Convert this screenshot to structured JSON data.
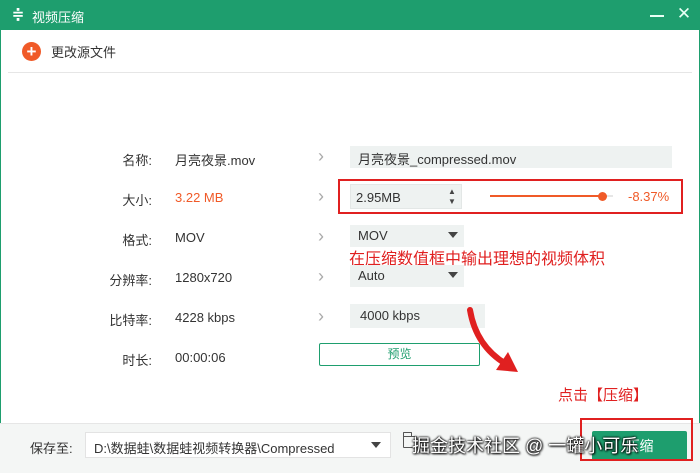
{
  "window": {
    "title": "视频压缩"
  },
  "toolbar": {
    "change_source_label": "更改源文件"
  },
  "rows": {
    "name": {
      "label": "名称:",
      "value": "月亮夜景.mov",
      "output": "月亮夜景_compressed.mov"
    },
    "size": {
      "label": "大小:",
      "value": "3.22 MB",
      "output": "2.95MB",
      "slider_fraction": 0.9163,
      "percent": "-8.37%"
    },
    "format": {
      "label": "格式:",
      "value": "MOV",
      "selected": "MOV"
    },
    "resolution": {
      "label": "分辨率:",
      "value": "1280x720",
      "selected": "Auto"
    },
    "bitrate": {
      "label": "比特率:",
      "value": "4228 kbps",
      "output": "4000 kbps"
    },
    "duration": {
      "label": "时长:",
      "value": "00:00:06",
      "preview_label": "预览"
    }
  },
  "annotations": {
    "size_hint": "在压缩数值框中输出理想的视频体积",
    "compress_hint": "点击【压缩】"
  },
  "bottom": {
    "save_label": "保存至:",
    "path": "D:\\数据蛙\\数据蛙视频转换器\\Compressed",
    "compress_label": "压缩"
  },
  "watermark": "掘金技术社区 @ 一罐小可乐",
  "colors": {
    "accent": "#1e9e6e",
    "orange": "#f05a28",
    "annotation_red": "#e02020"
  }
}
